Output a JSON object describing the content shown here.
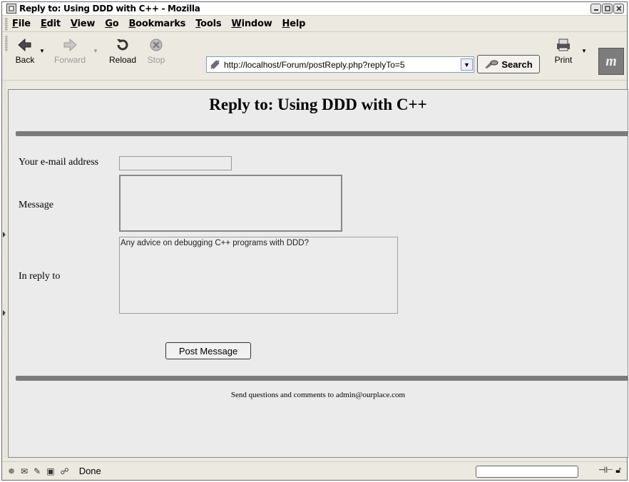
{
  "window": {
    "title": "Reply to: Using DDD with C++ - Mozilla"
  },
  "menu": {
    "items": [
      "File",
      "Edit",
      "View",
      "Go",
      "Bookmarks",
      "Tools",
      "Window",
      "Help"
    ]
  },
  "toolbar": {
    "back": "Back",
    "forward": "Forward",
    "reload": "Reload",
    "stop": "Stop",
    "url": "http://localhost/Forum/postReply.php?replyTo=5",
    "search": "Search",
    "print": "Print"
  },
  "page": {
    "heading": "Reply to: Using DDD with C++",
    "email_label": "Your e-mail address",
    "message_label": "Message",
    "reply_label": "In reply to",
    "reply_text": "Any advice on debugging C++ programs with DDD?",
    "post_button": "Post Message",
    "footer": "Send questions and comments to admin@ourplace.com"
  },
  "status": {
    "text": "Done"
  },
  "colors": {
    "rule": "#7b7b7b",
    "chrome": "#ece9e0",
    "page_bg": "#ebebeb"
  }
}
